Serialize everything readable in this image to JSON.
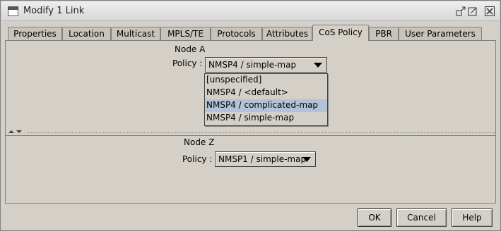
{
  "window": {
    "title": "Modify 1 Link"
  },
  "tabs": [
    {
      "label": "Properties",
      "active": false
    },
    {
      "label": "Location",
      "active": false
    },
    {
      "label": "Multicast",
      "active": false
    },
    {
      "label": "MPLS/TE",
      "active": false
    },
    {
      "label": "Protocols",
      "active": false
    },
    {
      "label": "Attributes",
      "active": false
    },
    {
      "label": "CoS Policy",
      "active": true
    },
    {
      "label": "PBR",
      "active": false
    },
    {
      "label": "User Parameters",
      "active": false
    }
  ],
  "node_a": {
    "heading": "Node A",
    "policy_label": "Policy :",
    "policy_value": "NMSP4 / simple-map",
    "options": [
      "[unspecified]",
      "NMSP4 / <default>",
      "NMSP4 / complicated-map",
      "NMSP4 / simple-map"
    ],
    "highlighted_option": "NMSP4 / complicated-map"
  },
  "node_z": {
    "heading": "Node Z",
    "policy_label": "Policy :",
    "policy_value": "NMSP1 / simple-map"
  },
  "buttons": {
    "ok": "OK",
    "cancel": "Cancel",
    "help": "Help"
  },
  "colors": {
    "background": "#d4d0c8",
    "highlight": "#b3c2d6"
  }
}
